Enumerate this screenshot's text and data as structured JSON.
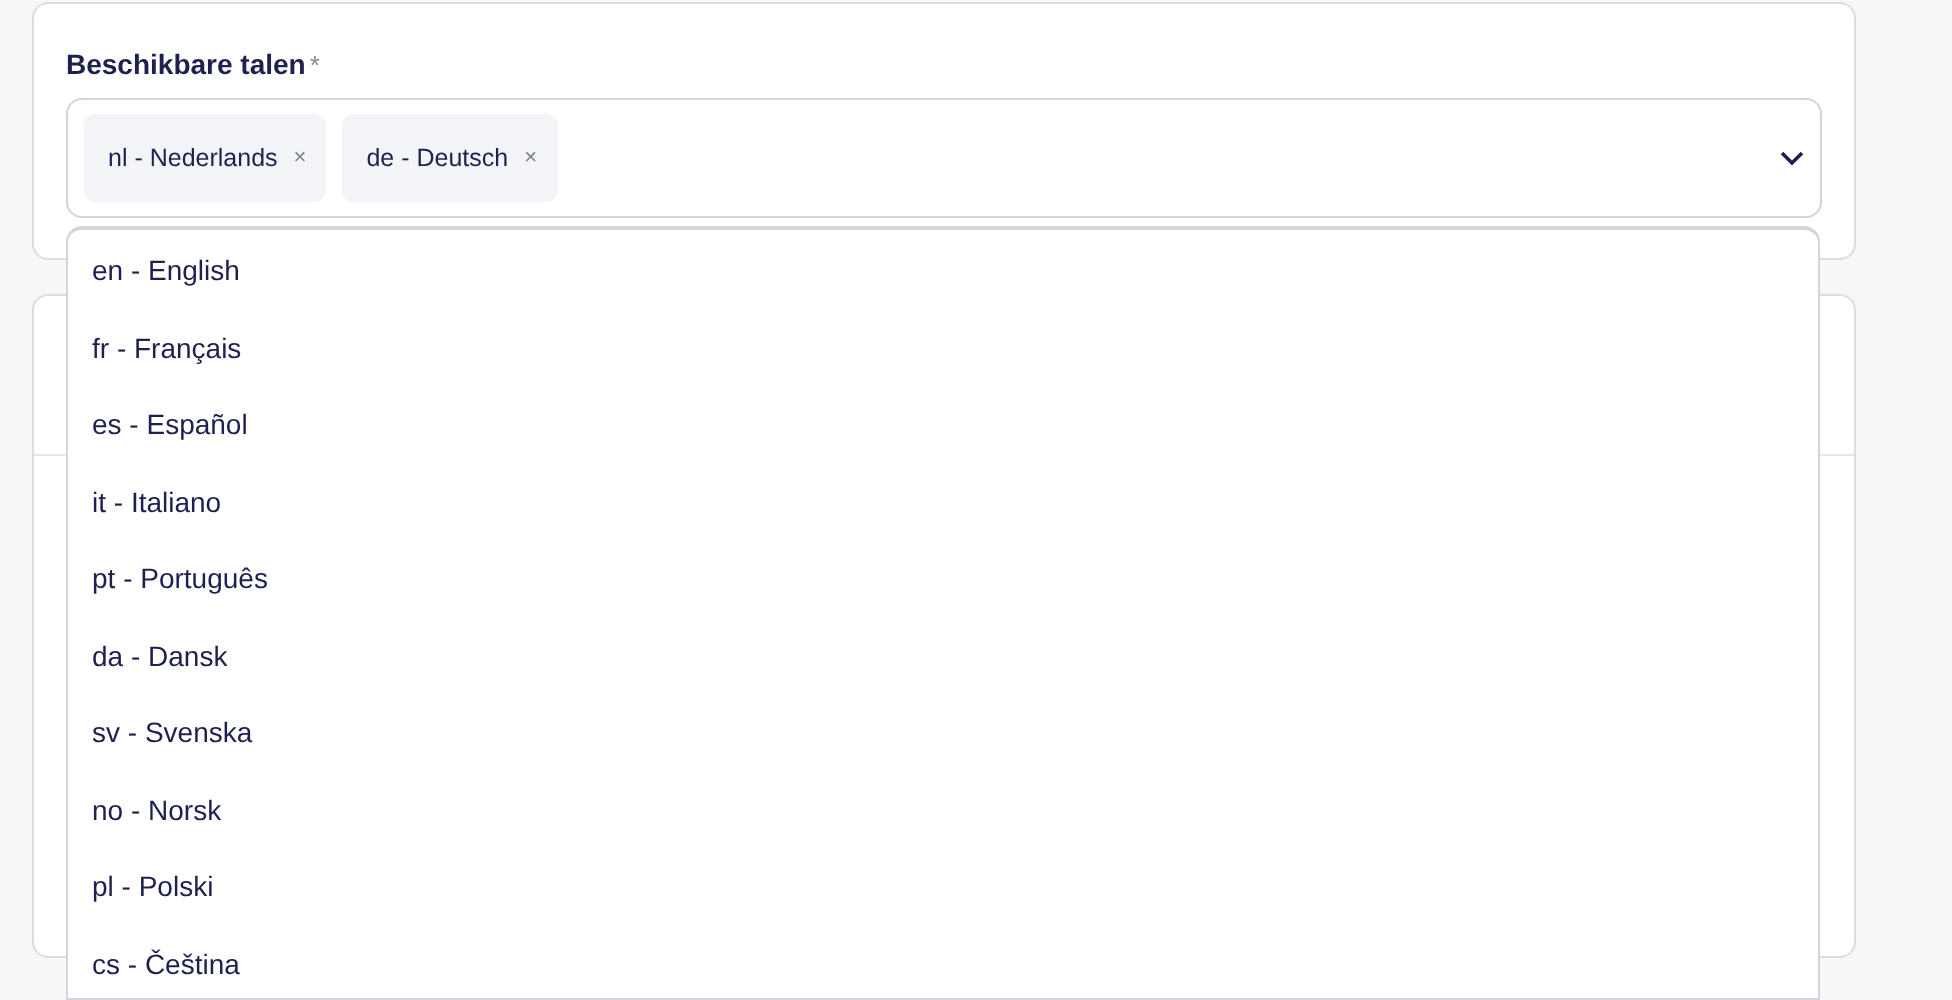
{
  "field": {
    "label": "Beschikbare talen",
    "required": true,
    "required_mark": "*",
    "chips": [
      {
        "label": "nl - Nederlands",
        "remove": "×"
      },
      {
        "label": "de - Deutsch",
        "remove": "×"
      }
    ],
    "expanded": true
  },
  "options": [
    {
      "label": "en - English"
    },
    {
      "label": "fr - Français"
    },
    {
      "label": "es - Español"
    },
    {
      "label": "it - Italiano"
    },
    {
      "label": "pt - Português"
    },
    {
      "label": "da - Dansk"
    },
    {
      "label": "sv - Svenska"
    },
    {
      "label": "no - Norsk"
    },
    {
      "label": "pl - Polski"
    },
    {
      "label": "cs - Čeština"
    }
  ]
}
